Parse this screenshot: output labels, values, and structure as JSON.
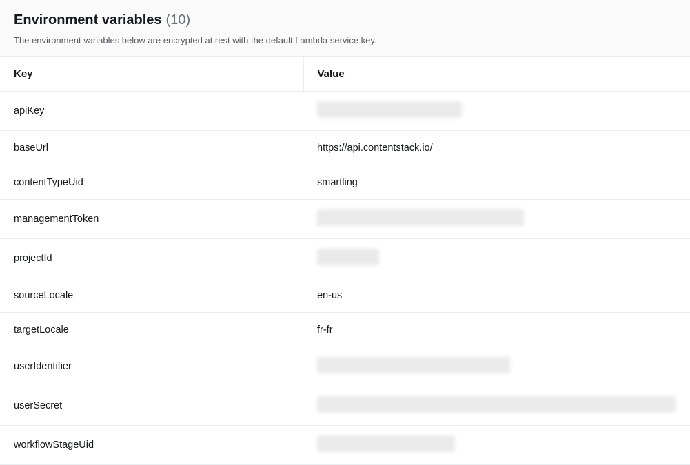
{
  "header": {
    "title": "Environment variables",
    "count": "(10)",
    "description": "The environment variables below are encrypted at rest with the default Lambda service key."
  },
  "columns": {
    "key": "Key",
    "value": "Value"
  },
  "rows": [
    {
      "key": "apiKey",
      "value": null,
      "redactClass": "w1"
    },
    {
      "key": "baseUrl",
      "value": "https://api.contentstack.io/",
      "redactClass": null
    },
    {
      "key": "contentTypeUid",
      "value": "smartling",
      "redactClass": null
    },
    {
      "key": "managementToken",
      "value": null,
      "redactClass": "w2"
    },
    {
      "key": "projectId",
      "value": null,
      "redactClass": "w3"
    },
    {
      "key": "sourceLocale",
      "value": "en-us",
      "redactClass": null
    },
    {
      "key": "targetLocale",
      "value": "fr-fr",
      "redactClass": null
    },
    {
      "key": "userIdentifier",
      "value": null,
      "redactClass": "w4"
    },
    {
      "key": "userSecret",
      "value": null,
      "redactClass": "w5"
    },
    {
      "key": "workflowStageUid",
      "value": null,
      "redactClass": "w6"
    }
  ]
}
